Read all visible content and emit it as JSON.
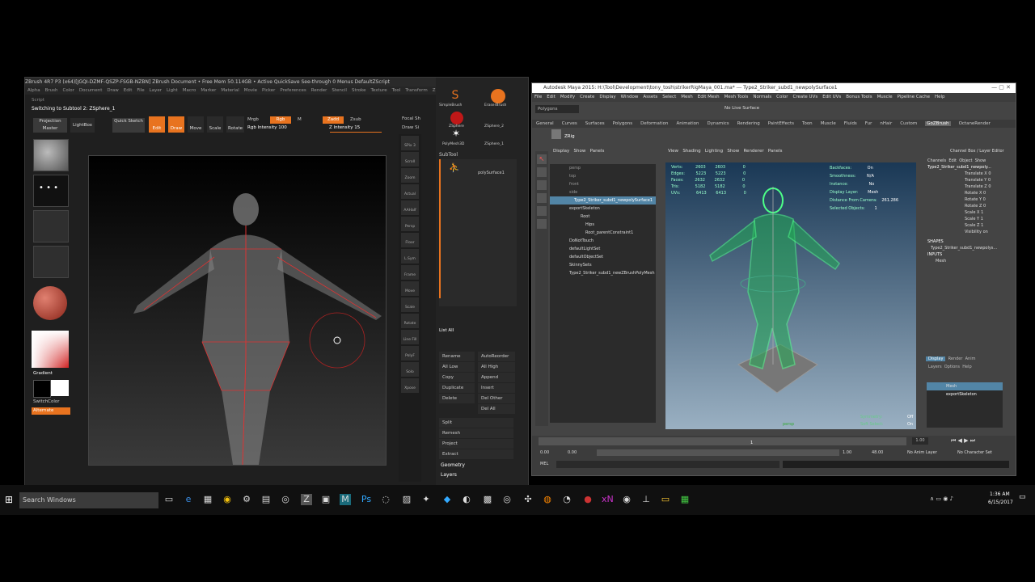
{
  "zbrush": {
    "title": "ZBrush 4R7 P3 (x64)[JGQI-DZMF-QSZP-FSGB-NZBN]     ZBrush Document     • Free Mem 50.114GB • Active  QuickSave  See-through 0  Menus  DefaultZScript",
    "menu": [
      "Alpha",
      "Brush",
      "Color",
      "Document",
      "Draw",
      "Edit",
      "File",
      "Layer",
      "Light",
      "Macro",
      "Marker",
      "Material",
      "Movie",
      "Picker",
      "Preferences",
      "Render",
      "Stencil",
      "Stroke",
      "Texture",
      "Tool",
      "Transform",
      "Zplugin"
    ],
    "script_label": "Script",
    "subtool_msg": "Switching to Subtool 2: ZSphere_1",
    "projection_master": "Projection Master",
    "lightbox": "LightBox",
    "quick_sketch": "Quick Sketch",
    "edit": "Edit",
    "draw": "Draw",
    "move": "Move",
    "scale": "Scale",
    "rotate": "Rotate",
    "mrgb": "Mrgb",
    "rgb": "Rgb",
    "m": "M",
    "zadd": "Zadd",
    "zsub": "Zsub",
    "rgb_intensity": "Rgb Intensity 100",
    "z_intensity": "Z Intensity 15",
    "focal_shift": "Focal Sh",
    "draw_size": "Draw Si",
    "gradient": "Gradient",
    "switch_color": "SwitchColor",
    "alternate": "Alternate",
    "right_tools": [
      "SPix 3",
      "Scroll",
      "Zoom",
      "Actual",
      "AAHalf",
      "Persp",
      "Floor",
      "L.Sym",
      "Frame",
      "Move",
      "Scale",
      "Rotate",
      "Line Fill",
      "PolyF",
      "Solo",
      "Xpose"
    ],
    "brushes": [
      "SimpleBrush",
      "EraserBrush",
      "ZSphere",
      "ZSphere_2",
      "PolyMesh3D",
      "ZSphere_1"
    ],
    "subtool_header": "SubTool",
    "subtool_item": "polySurface1",
    "list_all": "List All",
    "actions_left": [
      "Rename",
      "All Low",
      "Copy",
      "Duplicate",
      "Delete"
    ],
    "actions_right": [
      "AutoReorder",
      "All High",
      "Append",
      "Insert",
      "Del Other",
      "Del All"
    ],
    "panel_sections": [
      "Split",
      "Remesh",
      "Project",
      "Extract",
      "Geometry",
      "Layers"
    ]
  },
  "maya": {
    "title": "Autodesk Maya 2015: H:\\Tool\\Development\\tony_tosh\\strikerRigMaya_001.ma*   ---   Type2_Striker_subd1_newpolySurface1",
    "menu": [
      "File",
      "Edit",
      "Modify",
      "Create",
      "Display",
      "Window",
      "Assets",
      "Select",
      "Mesh",
      "Edit Mesh",
      "Mesh Tools",
      "Normals",
      "Color",
      "Create UVs",
      "Edit UVs",
      "Bonus Tools",
      "Muscle",
      "Pipeline Cache",
      "Help"
    ],
    "mode": "Polygons",
    "no_live": "No Live Surface",
    "shelf_tabs": [
      "General",
      "Curves",
      "Surfaces",
      "Polygons",
      "Deformation",
      "Animation",
      "Dynamics",
      "Rendering",
      "PaintEffects",
      "Toon",
      "Muscle",
      "Fluids",
      "Fur",
      "nHair",
      "Custom",
      "GoZBrush",
      "OctaneRender"
    ],
    "zrig": "ZRig",
    "outliner_menu": [
      "Display",
      "Show",
      "Panels"
    ],
    "outliner": [
      "persp",
      "top",
      "front",
      "side",
      "Type2_Striker_subd1_newpolySurface1",
      "exportSkeleton",
      "Root",
      "Hips",
      "Root_parentConstraint1",
      "DoNotTouch",
      "defaultLightSet",
      "defaultObjectSet",
      "SkinnySets",
      "Type2_Striker_subd1_newZBrushPolyMesh"
    ],
    "view_menu": [
      "View",
      "Shading",
      "Lighting",
      "Show",
      "Renderer",
      "Panels"
    ],
    "hud_left": [
      [
        "Verts:",
        "2603",
        "2603",
        "0"
      ],
      [
        "Edges:",
        "5223",
        "5223",
        "0"
      ],
      [
        "Faces:",
        "2632",
        "2632",
        "0"
      ],
      [
        "Tris:",
        "5182",
        "5182",
        "0"
      ],
      [
        "UVs:",
        "6413",
        "6413",
        "0"
      ]
    ],
    "hud_right": [
      [
        "Backfaces:",
        "On"
      ],
      [
        "Smoothness:",
        "N/A"
      ],
      [
        "Instance:",
        "No"
      ],
      [
        "Display Layer:",
        "Mesh"
      ],
      [
        "Distance From Camera:",
        "261.286"
      ],
      [
        "Selected Objects:",
        "1"
      ]
    ],
    "symmetry": "Symmetry:",
    "symmetry_val": "Off",
    "soft_select": "Soft Select:",
    "soft_val": "On",
    "persp": "persp",
    "channel_header": [
      "Channels",
      "Edit",
      "Object",
      "Show"
    ],
    "channel_title": "Channel Box / Layer Editor",
    "object_name": "Type2_Striker_subd1_newpoly...",
    "channels": [
      [
        "Translate X",
        "0"
      ],
      [
        "Translate Y",
        "0"
      ],
      [
        "Translate Z",
        "0"
      ],
      [
        "Rotate X",
        "0"
      ],
      [
        "Rotate Y",
        "0"
      ],
      [
        "Rotate Z",
        "0"
      ],
      [
        "Scale X",
        "1"
      ],
      [
        "Scale Y",
        "1"
      ],
      [
        "Scale Z",
        "1"
      ],
      [
        "Visibility",
        "on"
      ]
    ],
    "shapes_label": "SHAPES",
    "shape_name": "Type2_Striker_subd1_newpolys...",
    "inputs_label": "INPUTS",
    "input_name": "Mesh",
    "layer_tabs": [
      "Display",
      "Render",
      "Anim"
    ],
    "layer_menu": [
      "Layers",
      "Options",
      "Help"
    ],
    "layers": [
      "Mesh",
      "exportSkeleton"
    ],
    "time_start": "0.00",
    "time_start2": "0.00",
    "time_end": "1.00",
    "time_end2": "48.00",
    "current_frame": "1.00",
    "anim_layer": "No Anim Layer",
    "char_set": "No Character Set",
    "mel": "MEL"
  },
  "taskbar": {
    "search_placeholder": "Search Windows",
    "time": "1:36 AM",
    "date": "6/15/2017"
  }
}
